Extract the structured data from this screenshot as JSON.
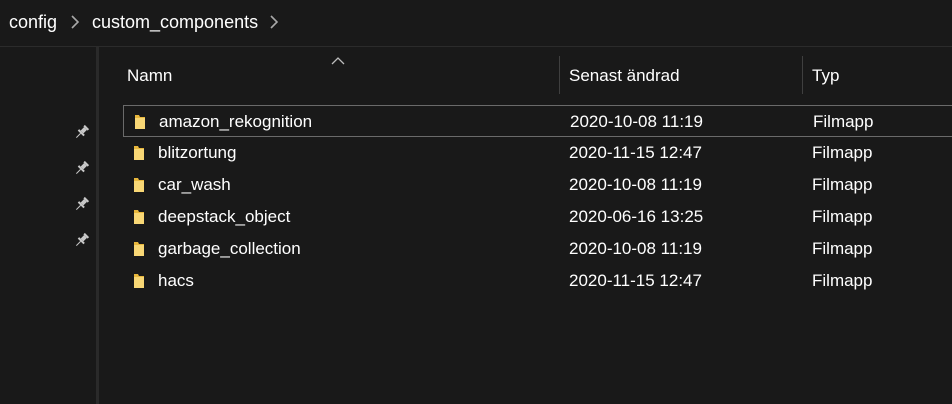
{
  "breadcrumb": {
    "items": [
      "config",
      "custom_components"
    ]
  },
  "columns": {
    "name": "Namn",
    "modified": "Senast ändrad",
    "type": "Typ",
    "sort": "ascending"
  },
  "files": [
    {
      "name": "amazon_rekognition",
      "modified": "2020-10-08 11:19",
      "type": "Filmapp",
      "focused": true
    },
    {
      "name": "blitzortung",
      "modified": "2020-11-15 12:47",
      "type": "Filmapp"
    },
    {
      "name": "car_wash",
      "modified": "2020-10-08 11:19",
      "type": "Filmapp"
    },
    {
      "name": "deepstack_object",
      "modified": "2020-06-16 13:25",
      "type": "Filmapp"
    },
    {
      "name": "garbage_collection",
      "modified": "2020-10-08 11:19",
      "type": "Filmapp"
    },
    {
      "name": "hacs",
      "modified": "2020-11-15 12:47",
      "type": "Filmapp"
    }
  ],
  "icons": {
    "folder": "folder-icon",
    "pin": "pin-icon",
    "chevron": "chevron-right-icon",
    "sort": "sort-up-icon"
  },
  "colors": {
    "background": "#191919",
    "folder_light": "#f8d775",
    "folder_dark": "#e8b73c",
    "text": "#ffffff"
  }
}
